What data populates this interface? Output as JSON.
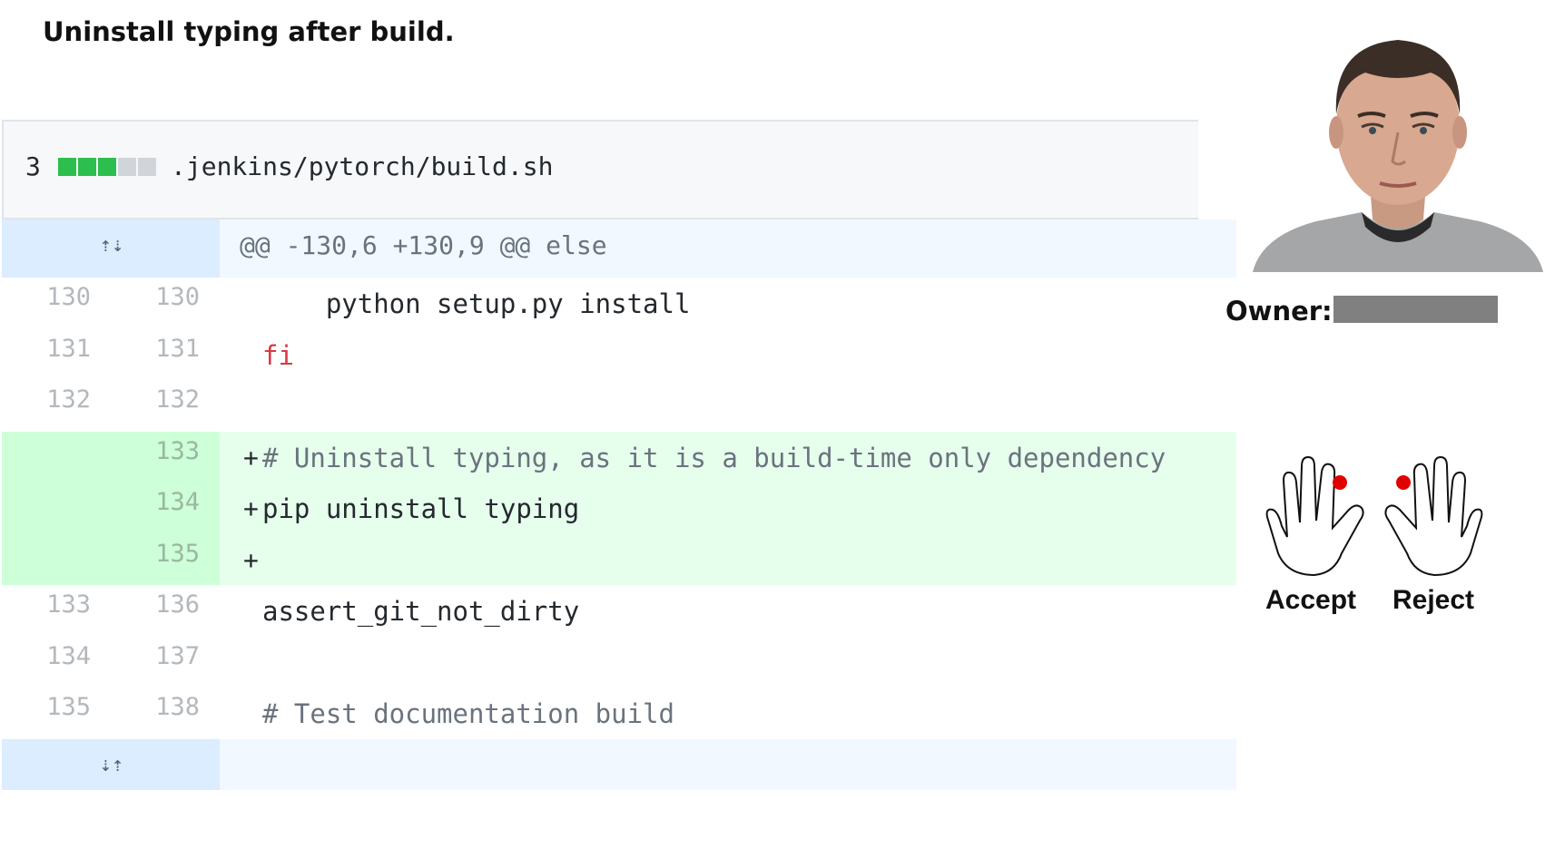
{
  "title": "Uninstall typing after build.",
  "file": {
    "change_count": "3",
    "path": ".jenkins/pytorch/build.sh",
    "diffstat": [
      "added",
      "added",
      "added",
      "neutral",
      "neutral"
    ]
  },
  "hunk_header": "@@ -130,6 +130,9 @@ else",
  "lines": [
    {
      "old": "130",
      "new": "130",
      "sign": "",
      "code": "    python setup.py install",
      "kind": "context"
    },
    {
      "old": "131",
      "new": "131",
      "sign": "",
      "code": "fi",
      "kind": "context-keyword"
    },
    {
      "old": "132",
      "new": "132",
      "sign": "",
      "code": "",
      "kind": "context"
    },
    {
      "old": "",
      "new": "133",
      "sign": "+",
      "code": "# Uninstall typing, as it is a build-time only dependency",
      "kind": "add-comment"
    },
    {
      "old": "",
      "new": "134",
      "sign": "+",
      "code": "pip uninstall typing",
      "kind": "add"
    },
    {
      "old": "",
      "new": "135",
      "sign": "+",
      "code": "",
      "kind": "add"
    },
    {
      "old": "133",
      "new": "136",
      "sign": "",
      "code": "assert_git_not_dirty",
      "kind": "context"
    },
    {
      "old": "134",
      "new": "137",
      "sign": "",
      "code": "",
      "kind": "context"
    },
    {
      "old": "135",
      "new": "138",
      "sign": "",
      "code": "# Test documentation build",
      "kind": "context-comment"
    }
  ],
  "owner": {
    "label": "Owner:"
  },
  "actions": {
    "accept": "Accept",
    "reject": "Reject"
  },
  "colors": {
    "added": "#2cbe4e",
    "neutral": "#d1d5da",
    "hunk_gutter": "#dbedff",
    "hunk_code": "#f1f8ff",
    "add_gutter": "#cdffd8",
    "add_code": "#e6ffed",
    "finger_marker": "#e00000"
  }
}
